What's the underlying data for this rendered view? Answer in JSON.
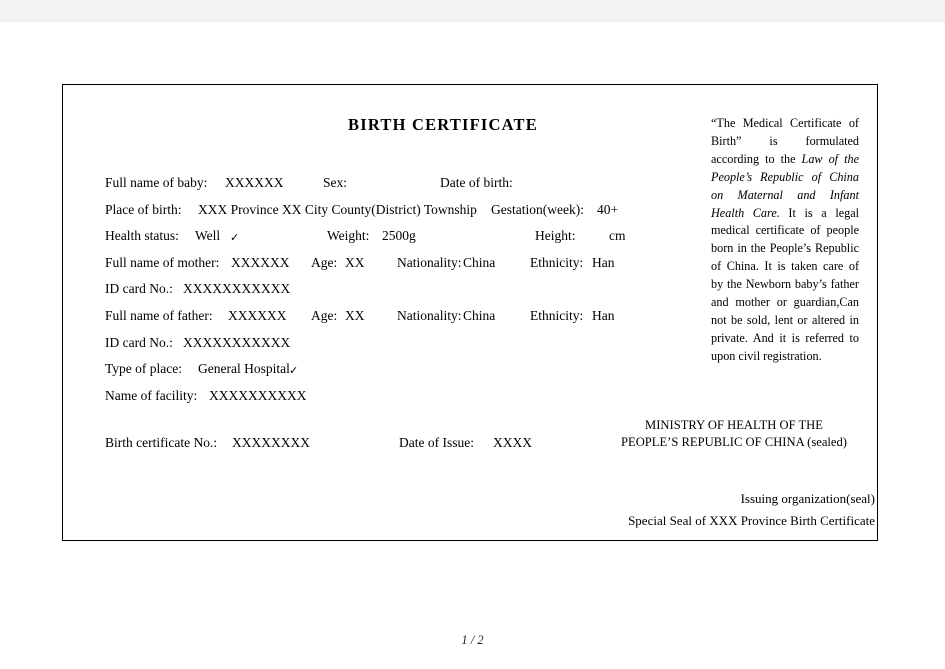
{
  "document": {
    "title": "BIRTH CERTIFICATE",
    "page_label": "1 / 2",
    "fields": {
      "full_name_baby_label": "Full name of baby:",
      "full_name_baby_value": "XXXXXX",
      "sex_label": "Sex:",
      "sex_value": "",
      "date_of_birth_label": "Date of birth:",
      "date_of_birth_value": "",
      "place_of_birth_label": "Place of birth:",
      "place_of_birth_value": "XXX Province XX City County(District) Township",
      "gestation_label": "Gestation(week):",
      "gestation_value": "40+",
      "health_status_label": "Health status:",
      "health_status_value": "Well",
      "health_status_check": "✓",
      "weight_label": "Weight:",
      "weight_value": "2500g",
      "height_label": "Height:",
      "height_value": "cm",
      "mother_name_label": "Full name of mother:",
      "mother_name_value": "XXXXXX",
      "mother_age_label": "Age:",
      "mother_age_value": "XX",
      "mother_nationality_label": "Nationality:",
      "mother_nationality_value": "China",
      "mother_ethnicity_label": "Ethnicity:",
      "mother_ethnicity_value": "Han",
      "mother_id_label": "ID card No.:",
      "mother_id_value": "XXXXXXXXXXX",
      "father_name_label": "Full name of father:",
      "father_name_value": "XXXXXX",
      "father_age_label": "Age:",
      "father_age_value": "XX",
      "father_nationality_label": "Nationality:",
      "father_nationality_value": "China",
      "father_ethnicity_label": "Ethnicity:",
      "father_ethnicity_value": "Han",
      "father_id_label": "ID card No.:",
      "father_id_value": "XXXXXXXXXXX",
      "type_of_place_label": "Type of place:",
      "type_of_place_value": "General Hospital",
      "type_of_place_check": "✓",
      "name_of_facility_label": "Name of facility:",
      "name_of_facility_value": "XXXXXXXXXX",
      "birth_cert_no_label": "Birth certificate No.:",
      "birth_cert_no_value": "XXXXXXXX",
      "date_of_issue_label": "Date of Issue:",
      "date_of_issue_value": "XXXX"
    },
    "notice": {
      "part1": "“The Medical Certificate of Birth” is formulated according to the ",
      "law_name": "Law of the People’s Republic of China on Maternal and Infant Health Care.",
      "part2": " It is a legal medical certificate of people born in the People’s Republic of China. It is taken care of by the Newborn baby’s father and mother or guardian,Can not be sold, lent or altered in private. And it is referred to upon civil registration."
    },
    "ministry": {
      "line1": "MINISTRY OF HEALTH OF THE",
      "line2": "PEOPLE’S REPUBLIC OF CHINA (sealed)"
    },
    "seals": {
      "issuing_organization": "Issuing organization(seal)",
      "special_seal": "Special Seal of XXX Province Birth Certificate"
    }
  }
}
